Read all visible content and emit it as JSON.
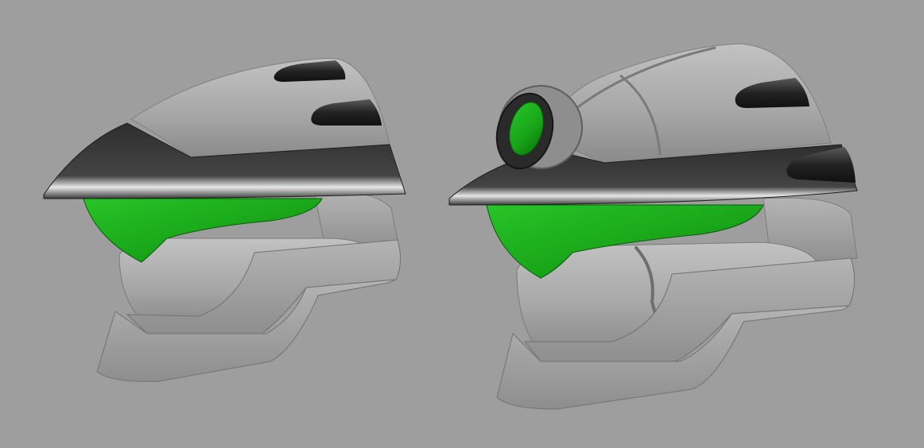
{
  "scene": {
    "background_color": "#9e9e9e",
    "subject_count": 2,
    "subjects": [
      {
        "label": "helmet-basic",
        "visor_color": "#1faa1f",
        "shell_color": "#a9a9a9",
        "brim_color": "#3a3a3a",
        "fin_count": 2
      },
      {
        "label": "helmet-with-scope",
        "visor_color": "#1faa1f",
        "shell_color": "#a9a9a9",
        "brim_color": "#3a3a3a",
        "fin_count": 2,
        "has_scope_ring": true
      }
    ]
  }
}
